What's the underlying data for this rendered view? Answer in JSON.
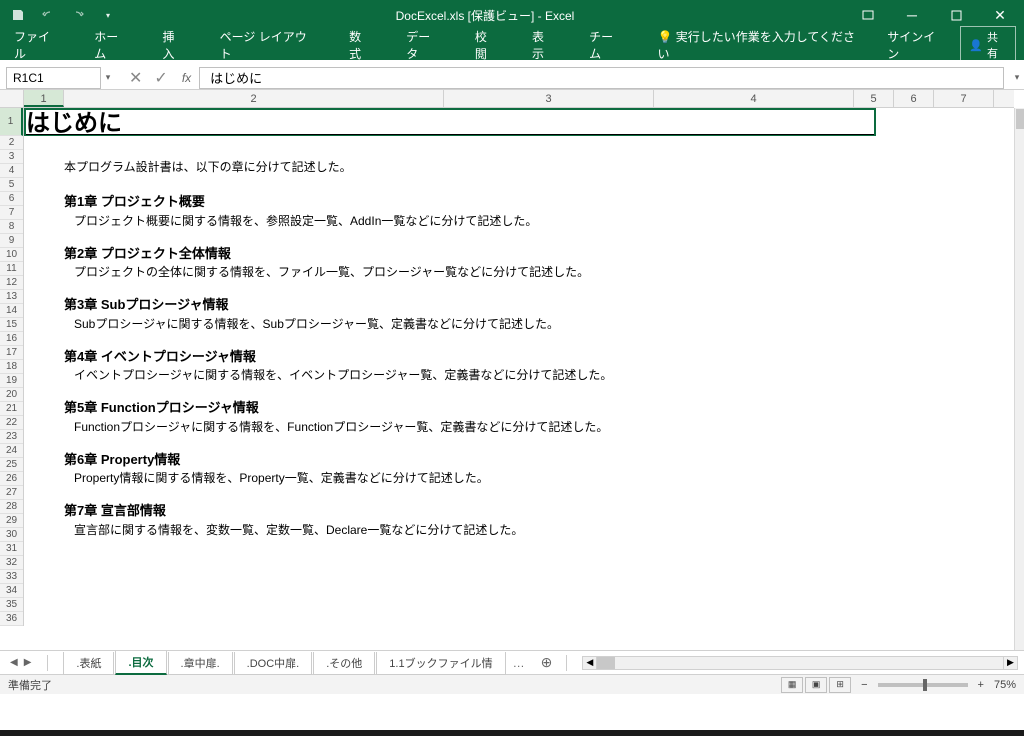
{
  "titlebar": {
    "title": "DocExcel.xls [保護ビュー] - Excel"
  },
  "ribbon": {
    "tabs": [
      "ファイル",
      "ホーム",
      "挿入",
      "ページ レイアウト",
      "数式",
      "データ",
      "校閲",
      "表示",
      "チーム"
    ],
    "tellme_icon": "💡",
    "tellme": "実行したい作業を入力してください",
    "signin": "サインイン",
    "share": "共有"
  },
  "fxbar": {
    "namebox": "R1C1",
    "formula": "はじめに"
  },
  "columns": [
    "1",
    "2",
    "3",
    "4",
    "5",
    "6",
    "7"
  ],
  "rows": [
    "1",
    "2",
    "3",
    "4",
    "5",
    "6",
    "7",
    "8",
    "9",
    "10",
    "11",
    "12",
    "13",
    "14",
    "15",
    "16",
    "17",
    "18",
    "19",
    "20",
    "21",
    "22",
    "23",
    "24",
    "25",
    "26",
    "27",
    "28",
    "29",
    "30",
    "31",
    "32",
    "33",
    "34",
    "35",
    "36"
  ],
  "doc": {
    "title": "はじめに",
    "intro": "本プログラム設計書は、以下の章に分けて記述した。",
    "chapters": [
      {
        "h": "第1章 プロジェクト概要",
        "d": "プロジェクト概要に関する情報を、参照設定一覧、AddIn一覧などに分けて記述した。"
      },
      {
        "h": "第2章 プロジェクト全体情報",
        "d": "プロジェクトの全体に関する情報を、ファイル一覧、プロシージャー覧などに分けて記述した。"
      },
      {
        "h": "第3章 Subプロシージャ情報",
        "d": "Subプロシージャに関する情報を、Subプロシージャー覧、定義書などに分けて記述した。"
      },
      {
        "h": "第4章 イベントプロシージャ情報",
        "d": "イベントプロシージャに関する情報を、イベントプロシージャー覧、定義書などに分けて記述した。"
      },
      {
        "h": "第5章 Functionプロシージャ情報",
        "d": "Functionプロシージャに関する情報を、Functionプロシージャー覧、定義書などに分けて記述した。"
      },
      {
        "h": "第6章 Property情報",
        "d": "Property情報に関する情報を、Property一覧、定義書などに分けて記述した。"
      },
      {
        "h": "第7章 宣言部情報",
        "d": "宣言部に関する情報を、変数一覧、定数一覧、Declare一覧などに分けて記述した。"
      }
    ]
  },
  "sheets": [
    {
      "name": ".表紙",
      "active": false
    },
    {
      "name": ".目次",
      "active": true
    },
    {
      "name": ".章中扉.",
      "active": false
    },
    {
      "name": ".DOC中扉.",
      "active": false
    },
    {
      "name": ".その他",
      "active": false
    },
    {
      "name": "1.1ブックファイル情",
      "active": false
    }
  ],
  "status": {
    "ready": "準備完了",
    "zoom": "75%"
  }
}
